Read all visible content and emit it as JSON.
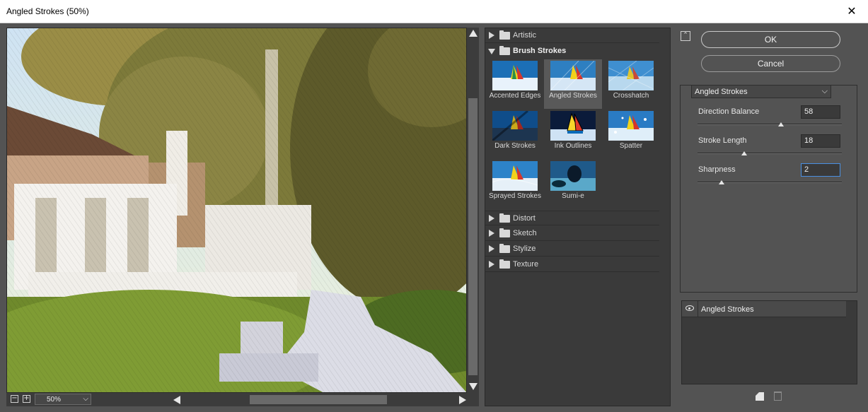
{
  "window": {
    "title": "Angled Strokes (50%)",
    "close_glyph": "✕"
  },
  "preview": {
    "zoom": "50%",
    "zoom_out_glyph": "−",
    "zoom_in_glyph": "+",
    "dropdown_glyph": "⌵"
  },
  "filter_gallery": {
    "categories": [
      {
        "label": "Artistic",
        "expanded": false
      },
      {
        "label": "Brush Strokes",
        "expanded": true
      },
      {
        "label": "Distort",
        "expanded": false
      },
      {
        "label": "Sketch",
        "expanded": false
      },
      {
        "label": "Stylize",
        "expanded": false
      },
      {
        "label": "Texture",
        "expanded": false
      }
    ],
    "brush_strokes": [
      {
        "label": "Accented Edges"
      },
      {
        "label": "Angled Strokes",
        "selected": true
      },
      {
        "label": "Crosshatch"
      },
      {
        "label": "Dark Strokes"
      },
      {
        "label": "Ink Outlines"
      },
      {
        "label": "Spatter"
      },
      {
        "label": "Sprayed Strokes"
      },
      {
        "label": "Sumi-e"
      }
    ]
  },
  "buttons": {
    "ok": "OK",
    "cancel": "Cancel",
    "collapse_glyph": "⌃"
  },
  "settings": {
    "filter": "Angled Strokes",
    "dropdown_glyph": "⌵",
    "params": [
      {
        "label": "Direction Balance",
        "value": "58",
        "max": 100
      },
      {
        "label": "Stroke Length",
        "value": "18",
        "max": 50
      },
      {
        "label": "Sharpness",
        "value": "2",
        "max": 10
      }
    ]
  },
  "effect_layers": [
    {
      "label": "Angled Strokes",
      "visible": true
    }
  ],
  "colors": {
    "accent_focus": "#4a90e2",
    "panel_bg": "#535353",
    "list_bg": "#3a3a3a"
  },
  "icons": [
    "close-icon",
    "zoom-out-icon",
    "zoom-in-icon",
    "folder-icon",
    "eye-icon",
    "new-layer-icon",
    "trash-icon",
    "collapse-icon"
  ]
}
